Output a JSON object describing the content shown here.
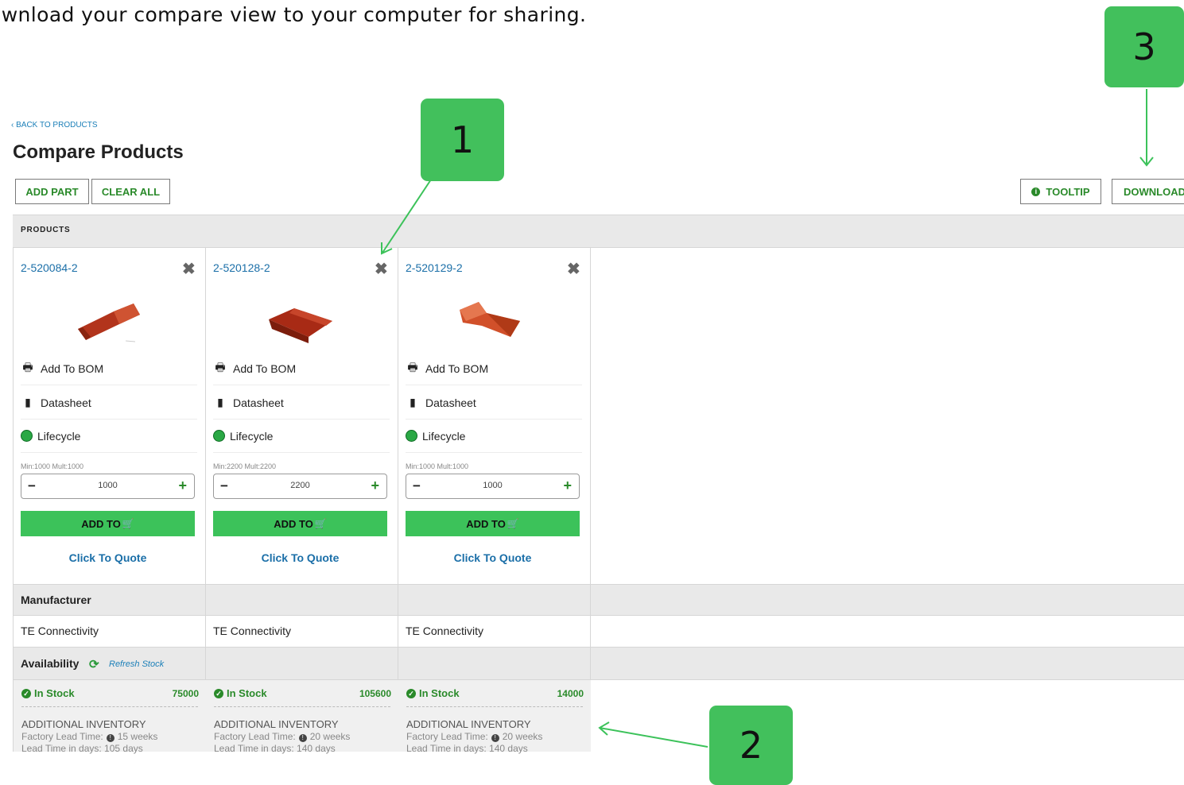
{
  "instruction": "ownload your compare view to your computer for sharing.",
  "header": {
    "back_link": "‹ BACK TO PRODUCTS",
    "title": "Compare Products"
  },
  "toolbar": {
    "add_part": "ADD PART",
    "clear_all": "CLEAR ALL",
    "tooltip": "TOOLTIP",
    "download": "DOWNLOAD"
  },
  "sections": {
    "products": "PRODUCTS",
    "manufacturer": "Manufacturer",
    "availability": "Availability",
    "refresh_stock": "Refresh Stock"
  },
  "products": [
    {
      "part": "2-520084-2",
      "add_to_bom": "Add To BOM",
      "datasheet": "Datasheet",
      "lifecycle": "Lifecycle",
      "min_mult": "Min:1000  Mult:1000",
      "qty": "1000",
      "add_to": "ADD TO",
      "quote": "Click To Quote",
      "manufacturer": "TE Connectivity",
      "stock_label": "In Stock",
      "stock_qty": "75000",
      "inv_title": "ADDITIONAL INVENTORY",
      "factory_lead_label": "Factory Lead Time:",
      "factory_lead_value": "15 weeks",
      "lead_days": "Lead Time in days:  105 days"
    },
    {
      "part": "2-520128-2",
      "add_to_bom": "Add To BOM",
      "datasheet": "Datasheet",
      "lifecycle": "Lifecycle",
      "min_mult": "Min:2200  Mult:2200",
      "qty": "2200",
      "add_to": "ADD TO",
      "quote": "Click To Quote",
      "manufacturer": "TE Connectivity",
      "stock_label": "In Stock",
      "stock_qty": "105600",
      "inv_title": "ADDITIONAL INVENTORY",
      "factory_lead_label": "Factory Lead Time:",
      "factory_lead_value": "20 weeks",
      "lead_days": "Lead Time in days:  140 days"
    },
    {
      "part": "2-520129-2",
      "add_to_bom": "Add To BOM",
      "datasheet": "Datasheet",
      "lifecycle": "Lifecycle",
      "min_mult": "Min:1000  Mult:1000",
      "qty": "1000",
      "add_to": "ADD TO",
      "quote": "Click To Quote",
      "manufacturer": "TE Connectivity",
      "stock_label": "In Stock",
      "stock_qty": "14000",
      "inv_title": "ADDITIONAL INVENTORY",
      "factory_lead_label": "Factory Lead Time:",
      "factory_lead_value": "20 weeks",
      "lead_days": "Lead Time in days:  140 days"
    }
  ],
  "callouts": [
    "1",
    "2",
    "3"
  ],
  "colors": {
    "accent_green": "#3cc25a",
    "link_blue": "#1b6fa8",
    "badge_green": "#42c05c"
  }
}
